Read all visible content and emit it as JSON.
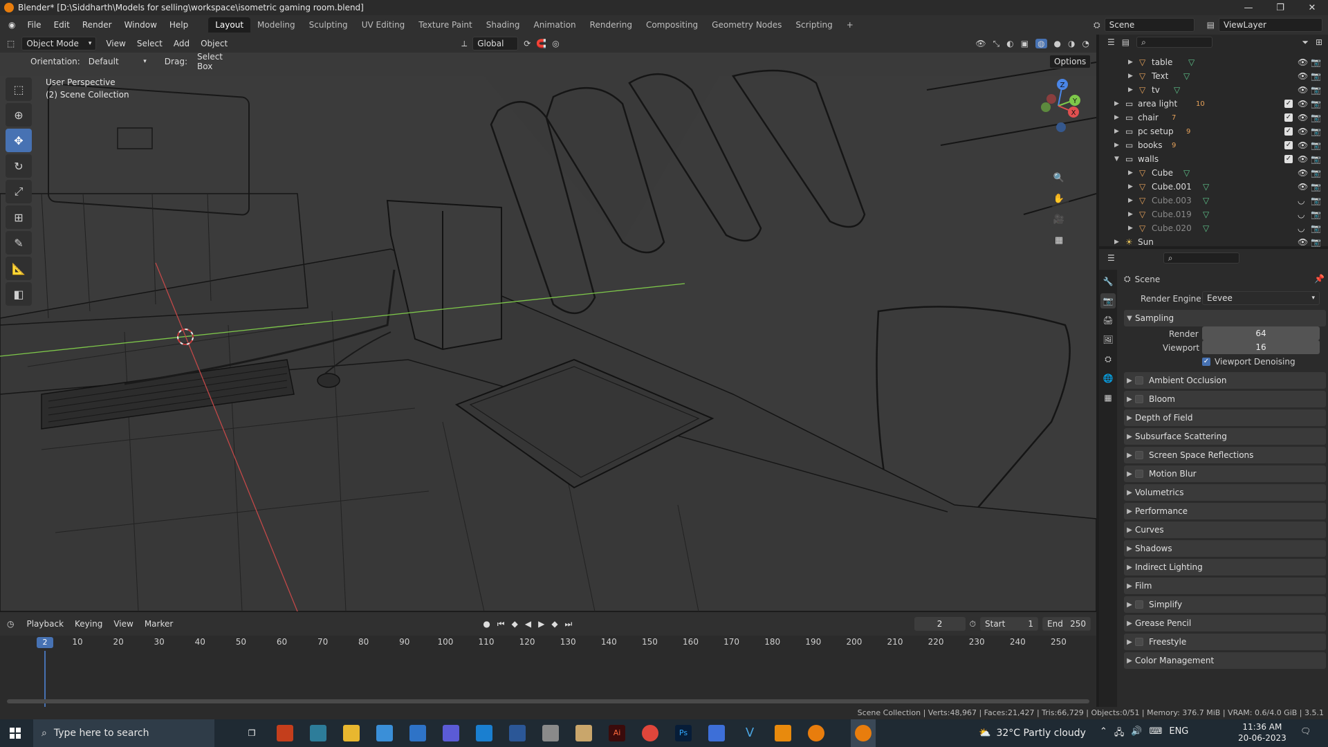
{
  "window": {
    "title": "Blender* [D:\\Siddharth\\Models for selling\\workspace\\isometric gaming room.blend]",
    "controls": [
      "—",
      "❐",
      "✕"
    ]
  },
  "topbar": {
    "menus": [
      "File",
      "Edit",
      "Render",
      "Window",
      "Help"
    ],
    "workspaces": [
      "Layout",
      "Modeling",
      "Sculpting",
      "UV Editing",
      "Texture Paint",
      "Shading",
      "Animation",
      "Rendering",
      "Compositing",
      "Geometry Nodes",
      "Scripting",
      "+"
    ],
    "active_workspace": "Layout",
    "scene": "Scene",
    "view_layer": "ViewLayer"
  },
  "viewport": {
    "mode": "Object Mode",
    "menus": [
      "View",
      "Select",
      "Add",
      "Object"
    ],
    "transform_orientation": "Global",
    "orientation_label": "Orientation:",
    "orientation_value": "Default",
    "drag_label": "Drag:",
    "drag_value": "Select Box",
    "options_label": "Options",
    "overlay_line1": "User Perspective",
    "overlay_line2": "(2) Scene Collection",
    "gizmo": {
      "x": "X",
      "y": "Y",
      "z": "Z"
    },
    "colors": {
      "x_axis": "#e05050",
      "y_axis": "#7ec84a",
      "z_axis": "#4a86e8",
      "wire": "#151515",
      "bg": "#3a3a3a"
    }
  },
  "toolbar": {
    "tools": [
      "select-box-icon",
      "cursor-icon",
      "move-icon",
      "rotate-icon",
      "scale-icon",
      "transform-icon",
      "annotate-icon",
      "measure-icon",
      "add-cube-icon"
    ],
    "active_index": 2
  },
  "timeline": {
    "menus": [
      "Playback",
      "Keying",
      "View",
      "Marker"
    ],
    "current_frame": "2",
    "start_label": "Start",
    "start_value": "1",
    "end_label": "End",
    "end_value": "250",
    "ticks": [
      "10",
      "20",
      "30",
      "40",
      "50",
      "60",
      "70",
      "80",
      "90",
      "100",
      "110",
      "120",
      "130",
      "140",
      "150",
      "160",
      "170",
      "180",
      "190",
      "200",
      "210",
      "220",
      "230",
      "240",
      "250"
    ],
    "playhead_label": "2"
  },
  "outliner": {
    "rows": [
      {
        "name": "table",
        "indent": 2,
        "type": "mesh",
        "check": false,
        "dim": false,
        "sub": ""
      },
      {
        "name": "Text",
        "indent": 2,
        "type": "mesh",
        "check": false,
        "dim": false,
        "sub": ""
      },
      {
        "name": "tv",
        "indent": 2,
        "type": "mesh",
        "check": false,
        "dim": false,
        "sub": ""
      },
      {
        "name": "area light",
        "indent": 1,
        "type": "collection",
        "check": true,
        "dim": false,
        "sub": "10"
      },
      {
        "name": "chair",
        "indent": 1,
        "type": "collection",
        "check": true,
        "dim": false,
        "sub": "7"
      },
      {
        "name": "pc setup",
        "indent": 1,
        "type": "collection",
        "check": true,
        "dim": false,
        "sub": "9"
      },
      {
        "name": "books",
        "indent": 1,
        "type": "collection",
        "check": true,
        "dim": false,
        "sub": "9"
      },
      {
        "name": "walls",
        "indent": 1,
        "type": "collection",
        "check": true,
        "dim": false,
        "sub": ""
      },
      {
        "name": "Cube",
        "indent": 2,
        "type": "mesh",
        "check": false,
        "dim": false,
        "sub": ""
      },
      {
        "name": "Cube.001",
        "indent": 2,
        "type": "mesh",
        "check": false,
        "dim": false,
        "sub": ""
      },
      {
        "name": "Cube.003",
        "indent": 2,
        "type": "mesh",
        "check": false,
        "dim": true,
        "sub": ""
      },
      {
        "name": "Cube.019",
        "indent": 2,
        "type": "mesh",
        "check": false,
        "dim": true,
        "sub": ""
      },
      {
        "name": "Cube.020",
        "indent": 2,
        "type": "mesh",
        "check": false,
        "dim": true,
        "sub": ""
      },
      {
        "name": "Sun",
        "indent": 1,
        "type": "light",
        "check": false,
        "dim": false,
        "sub": ""
      }
    ]
  },
  "properties": {
    "context": "Scene",
    "render_engine_label": "Render Engine",
    "render_engine_value": "Eevee",
    "sampling_label": "Sampling",
    "render_label": "Render",
    "render_value": "64",
    "viewport_label": "Viewport",
    "viewport_value": "16",
    "denoise_label": "Viewport Denoising",
    "panels": [
      {
        "label": "Ambient Occlusion",
        "cb": true
      },
      {
        "label": "Bloom",
        "cb": true
      },
      {
        "label": "Depth of Field",
        "cb": false
      },
      {
        "label": "Subsurface Scattering",
        "cb": false
      },
      {
        "label": "Screen Space Reflections",
        "cb": true
      },
      {
        "label": "Motion Blur",
        "cb": true
      },
      {
        "label": "Volumetrics",
        "cb": false
      },
      {
        "label": "Performance",
        "cb": false
      },
      {
        "label": "Curves",
        "cb": false
      },
      {
        "label": "Shadows",
        "cb": false
      },
      {
        "label": "Indirect Lighting",
        "cb": false
      },
      {
        "label": "Film",
        "cb": false
      },
      {
        "label": "Simplify",
        "cb": true
      },
      {
        "label": "Grease Pencil",
        "cb": false
      },
      {
        "label": "Freestyle",
        "cb": true
      },
      {
        "label": "Color Management",
        "cb": false
      }
    ]
  },
  "statusbar": {
    "text": "Scene Collection | Verts:48,967 | Faces:21,427 | Tris:66,729 | Objects:0/51 | Memory: 376.7 MiB | VRAM: 0.6/4.0 GiB | 3.5.1"
  },
  "taskbar": {
    "search_placeholder": "Type here to search",
    "weather": "32°C  Partly cloudy",
    "lang": "ENG",
    "time": "11:36 AM",
    "date": "20-06-2023"
  }
}
